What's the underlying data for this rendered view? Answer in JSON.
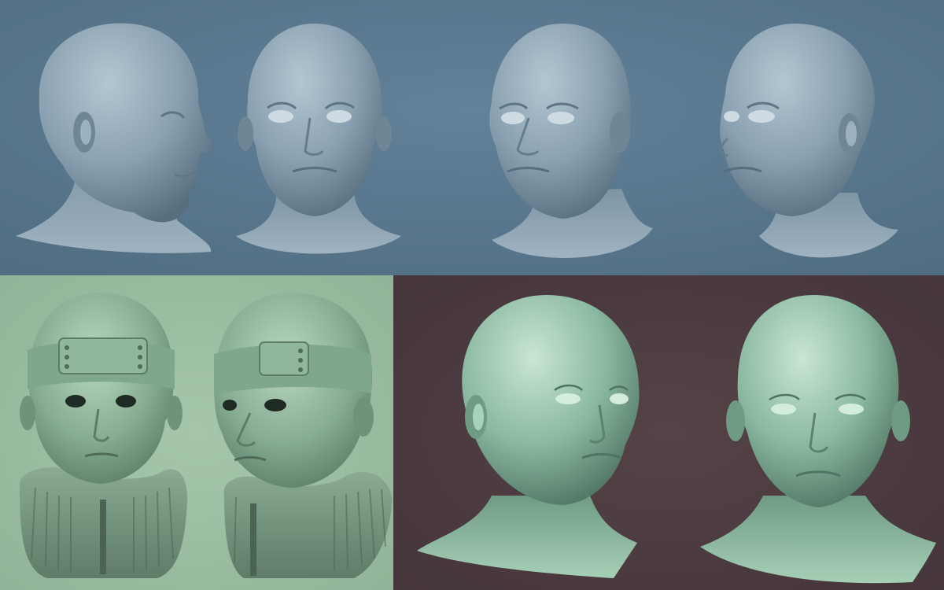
{
  "colors": {
    "top_background": "#5b7a8f",
    "top_skin": "#8fa6b6",
    "bottom_left_background": "#9dbfa4",
    "bottom_left_skin": "#86ac92",
    "bottom_right_background": "#4c3b3f",
    "bottom_right_skin": "#8ab8a0"
  },
  "panels": [
    {
      "name": "male-head-sculpt-panel",
      "heads": [
        "profile-right",
        "front",
        "three-quarter-left",
        "three-quarter-right"
      ]
    },
    {
      "name": "headband-character-panel",
      "heads": [
        "front",
        "three-quarter"
      ]
    },
    {
      "name": "female-head-sculpt-panel",
      "heads": [
        "three-quarter",
        "front"
      ]
    }
  ]
}
